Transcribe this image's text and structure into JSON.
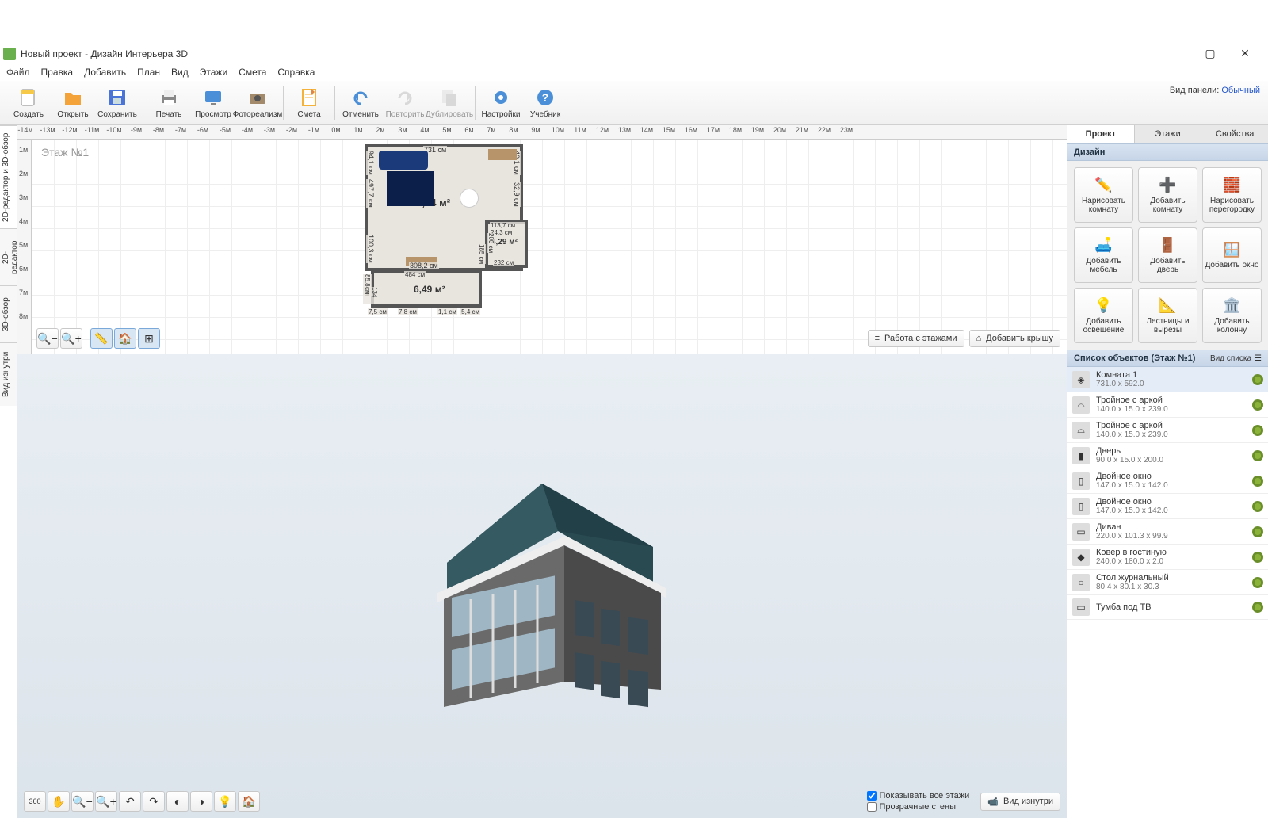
{
  "window": {
    "title": "Новый проект - Дизайн Интерьера 3D",
    "min": "—",
    "max": "▢",
    "close": "✕"
  },
  "menu": [
    "Файл",
    "Правка",
    "Добавить",
    "План",
    "Вид",
    "Этажи",
    "Смета",
    "Справка"
  ],
  "toolbar": [
    {
      "label": "Создать",
      "icon": "file",
      "color": "#f7c948"
    },
    {
      "label": "Открыть",
      "icon": "folder",
      "color": "#f4a23a"
    },
    {
      "label": "Сохранить",
      "icon": "save",
      "color": "#4a74d8"
    },
    {
      "sep": true
    },
    {
      "label": "Печать",
      "icon": "print",
      "color": "#888"
    },
    {
      "label": "Просмотр",
      "icon": "screen",
      "color": "#4a8fd8"
    },
    {
      "label": "Фотореализм",
      "icon": "camera",
      "color": "#a38a6a"
    },
    {
      "sep": true
    },
    {
      "label": "Смета",
      "icon": "note",
      "color": "#f4b23a"
    },
    {
      "sep": true
    },
    {
      "label": "Отменить",
      "icon": "undo",
      "color": "#4a8fd8"
    },
    {
      "label": "Повторить",
      "icon": "redo",
      "color": "#bbb",
      "disabled": true
    },
    {
      "label": "Дублировать",
      "icon": "dup",
      "color": "#bbb",
      "disabled": true
    },
    {
      "sep": true
    },
    {
      "label": "Настройки",
      "icon": "gear",
      "color": "#4a8fd8"
    },
    {
      "label": "Учебник",
      "icon": "help",
      "color": "#4a8fd8"
    }
  ],
  "panel_mode_label": "Вид панели:",
  "panel_mode_value": "Обычный",
  "left_tabs": [
    {
      "label": "2D-редактор и 3D-обзор",
      "active": true
    },
    {
      "label": "2D-редактор",
      "active": false
    },
    {
      "label": "3D-обзор",
      "active": false
    },
    {
      "label": "Вид изнутри",
      "active": false
    }
  ],
  "ruler_h": [
    "-14м",
    "-13м",
    "-12м",
    "-11м",
    "-10м",
    "-9м",
    "-8м",
    "-7м",
    "-6м",
    "-5м",
    "-4м",
    "-3м",
    "-2м",
    "-1м",
    "0м",
    "1м",
    "2м",
    "3м",
    "4м",
    "5м",
    "6м",
    "7м",
    "8м",
    "9м",
    "10м",
    "11м",
    "12м",
    "13м",
    "14м",
    "15м",
    "16м",
    "17м",
    "18м",
    "19м",
    "20м",
    "21м",
    "22м",
    "23м"
  ],
  "ruler_v": [
    "1м",
    "2м",
    "3м",
    "4м",
    "5м",
    "6м",
    "7м",
    "8м"
  ],
  "plan": {
    "floor_label": "Этаж №1",
    "main_area": "38,34 м²",
    "small_area1": "4,29 м²",
    "small_area2": "6,49 м²",
    "dims": {
      "top": "731 см",
      "left_upper": "94,1 см",
      "left_mid": "497,7 см",
      "left_lower": "100,3 см",
      "left_bottom": "85,8 см",
      "left_bottom2": "134 см",
      "bottom_left": "7,5 см",
      "bottom_mid": "7,8 см",
      "bottom_right": "1,1 см",
      "inner_bottom": "308,2 см",
      "inner_bottom2": "484 см",
      "inner_right": "200 см",
      "inner_right2": "185 см",
      "inner_right3": "232 см",
      "right_upper": "40.1 см",
      "right_mid": "32,9 см",
      "right_door": "113,7 см 24,3 см",
      "right_bottom": "5,4 см"
    }
  },
  "plan_tools": [
    "zoom-out",
    "zoom-in",
    "ruler",
    "home",
    "grid"
  ],
  "plan_right_btns": [
    {
      "label": "Работа с этажами",
      "icon": "layers"
    },
    {
      "label": "Добавить крышу",
      "icon": "roof"
    }
  ],
  "view3d_tools": [
    "rotate360",
    "hand",
    "zoom-out",
    "zoom-in",
    "orbit-l",
    "orbit-r",
    "lasso-l",
    "lasso-r",
    "bulb",
    "home"
  ],
  "view3d_checks": [
    {
      "label": "Показывать все этажи",
      "checked": true
    },
    {
      "label": "Прозрачные стены",
      "checked": false
    }
  ],
  "view3d_inside_btn": "Вид изнутри",
  "right_panel": {
    "tabs": [
      {
        "label": "Проект",
        "active": true
      },
      {
        "label": "Этажи",
        "active": false
      },
      {
        "label": "Свойства",
        "active": false
      }
    ],
    "design_header": "Дизайн",
    "design_buttons": [
      {
        "label": "Нарисовать комнату",
        "icon": "✏️",
        "color": "#d8a838"
      },
      {
        "label": "Добавить комнату",
        "icon": "➕",
        "color": "#4aa84a"
      },
      {
        "label": "Нарисовать перегородку",
        "icon": "🧱",
        "color": "#c86a4a"
      },
      {
        "label": "Добавить мебель",
        "icon": "🛋️",
        "color": "#5a8ad8"
      },
      {
        "label": "Добавить дверь",
        "icon": "🚪",
        "color": "#c88a3a"
      },
      {
        "label": "Добавить окно",
        "icon": "🪟",
        "color": "#5a8ad8"
      },
      {
        "label": "Добавить освещение",
        "icon": "💡",
        "color": "#e8c848"
      },
      {
        "label": "Лестницы и вырезы",
        "icon": "📐",
        "color": "#a86a4a"
      },
      {
        "label": "Добавить колонну",
        "icon": "🏛️",
        "color": "#aaa"
      }
    ],
    "objlist_header": "Список объектов (Этаж №1)",
    "objlist_viewlabel": "Вид списка",
    "objects": [
      {
        "name": "Комната 1",
        "dim": "731.0 x 592.0",
        "icon": "◈",
        "sel": true
      },
      {
        "name": "Тройное с аркой",
        "dim": "140.0 x 15.0 x 239.0",
        "icon": "⌓"
      },
      {
        "name": "Тройное с аркой",
        "dim": "140.0 x 15.0 x 239.0",
        "icon": "⌓"
      },
      {
        "name": "Дверь",
        "dim": "90.0 x 15.0 x 200.0",
        "icon": "▮"
      },
      {
        "name": "Двойное окно",
        "dim": "147.0 x 15.0 x 142.0",
        "icon": "▯"
      },
      {
        "name": "Двойное окно",
        "dim": "147.0 x 15.0 x 142.0",
        "icon": "▯"
      },
      {
        "name": "Диван",
        "dim": "220.0 x 101.3 x 99.9",
        "icon": "▭"
      },
      {
        "name": "Ковер в гостиную",
        "dim": "240.0 x 180.0 x 2.0",
        "icon": "◆"
      },
      {
        "name": "Стол журнальный",
        "dim": "80.4 x 80.1 x 30.3",
        "icon": "○"
      },
      {
        "name": "Тумба под ТВ",
        "dim": "",
        "icon": "▭"
      }
    ]
  }
}
